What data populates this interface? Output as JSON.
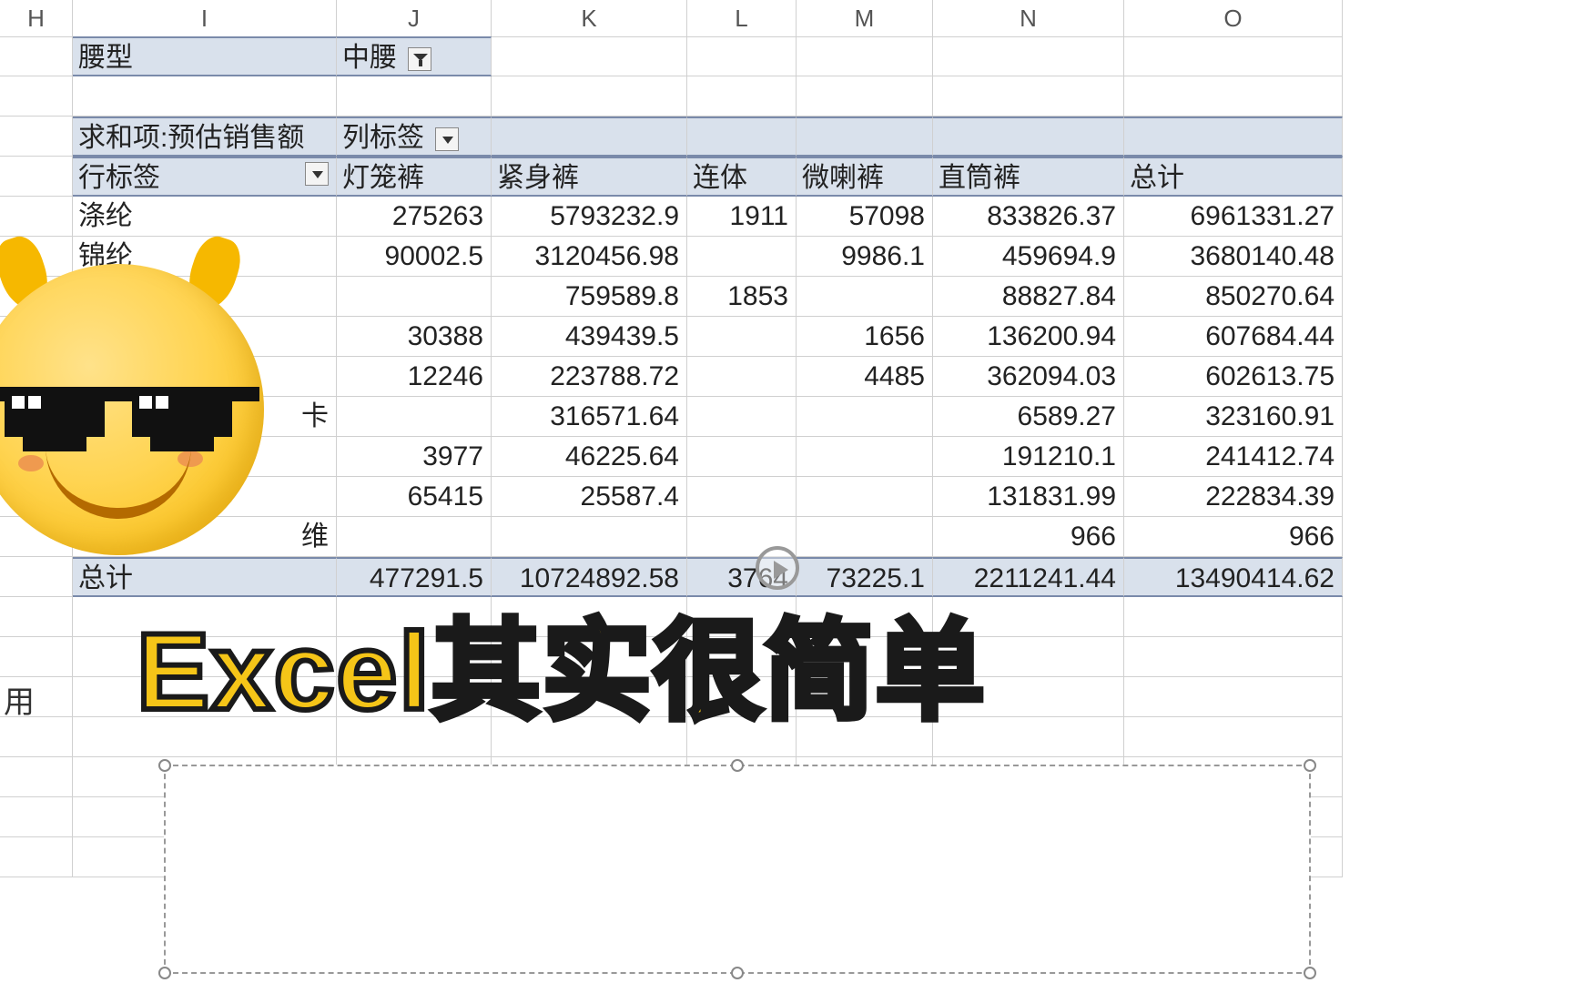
{
  "columns": [
    "H",
    "I",
    "J",
    "K",
    "L",
    "M",
    "N",
    "O"
  ],
  "filter": {
    "field": "腰型",
    "value": "中腰"
  },
  "pivot": {
    "measure_label": "求和项:预估销售额",
    "col_caption": "列标签",
    "row_caption": "行标签",
    "col_headers": [
      "灯笼裤",
      "紧身裤",
      "连体",
      "微喇裤",
      "直筒裤",
      "总计"
    ],
    "rows": [
      {
        "label": "涤纶",
        "v": [
          "275263",
          "5793232.9",
          "1911",
          "57098",
          "833826.37",
          "6961331.27"
        ]
      },
      {
        "label": "锦纶",
        "v": [
          "90002.5",
          "3120456.98",
          "",
          "9986.1",
          "459694.9",
          "3680140.48"
        ]
      },
      {
        "label": "",
        "v": [
          "",
          "759589.8",
          "1853",
          "",
          "88827.84",
          "850270.64"
        ]
      },
      {
        "label": "",
        "v": [
          "30388",
          "439439.5",
          "",
          "1656",
          "136200.94",
          "607684.44"
        ]
      },
      {
        "label": "",
        "v": [
          "12246",
          "223788.72",
          "",
          "4485",
          "362094.03",
          "602613.75"
        ]
      },
      {
        "label": "卡",
        "v": [
          "",
          "316571.64",
          "",
          "",
          "6589.27",
          "323160.91"
        ]
      },
      {
        "label": "",
        "v": [
          "3977",
          "46225.64",
          "",
          "",
          "191210.1",
          "241412.74"
        ]
      },
      {
        "label": "",
        "v": [
          "65415",
          "25587.4",
          "",
          "",
          "131831.99",
          "222834.39"
        ]
      },
      {
        "label": "维",
        "v": [
          "",
          "",
          "",
          "",
          "966",
          "966"
        ]
      }
    ],
    "total": {
      "label": "总计",
      "v": [
        "477291.5",
        "10724892.58",
        "3764",
        "73225.1",
        "2211241.44",
        "13490414.62"
      ]
    }
  },
  "side_char": "用",
  "overlay_text": "Excel其实很简单"
}
